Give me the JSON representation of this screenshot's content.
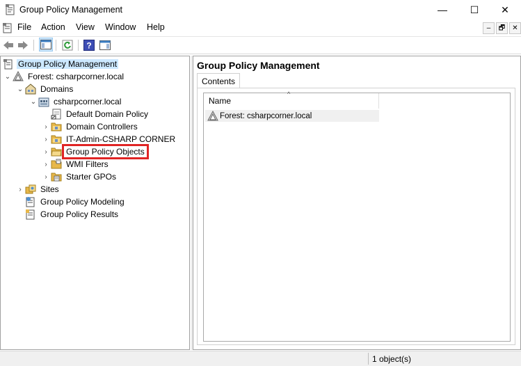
{
  "window": {
    "title": "Group Policy Management",
    "minimize_glyph": "—",
    "maximize_glyph": "☐",
    "close_glyph": "✕"
  },
  "menu": {
    "items": [
      "File",
      "Action",
      "View",
      "Window",
      "Help"
    ],
    "mdi_minimize": "–",
    "mdi_restore": "🗗",
    "mdi_close": "✕"
  },
  "toolbar": {
    "buttons": [
      "back-icon",
      "forward-icon",
      "show-hide-console-tree-icon",
      "refresh-icon",
      "help-icon",
      "show-action-pane-icon"
    ]
  },
  "tree": {
    "nodes": [
      {
        "label": "Group Policy Management",
        "icon": "gpm-icon",
        "selected": true
      },
      {
        "label": "Forest: csharpcorner.local",
        "icon": "forest-icon",
        "expander": "⌄"
      },
      {
        "label": "Domains",
        "icon": "domains-icon",
        "expander": "⌄"
      },
      {
        "label": "csharpcorner.local",
        "icon": "domain-icon",
        "expander": "⌄"
      },
      {
        "label": "Default Domain Policy",
        "icon": "gpo-link-icon"
      },
      {
        "label": "Domain Controllers",
        "icon": "ou-folder-icon",
        "expander": "›"
      },
      {
        "label": "IT-Admin-CSHARP CORNER",
        "icon": "ou-folder-icon",
        "expander": "›"
      },
      {
        "label": "Group Policy Objects",
        "icon": "gpo-folder-icon",
        "expander": "›",
        "highlighted": true
      },
      {
        "label": "WMI Filters",
        "icon": "wmi-folder-icon",
        "expander": "›"
      },
      {
        "label": "Starter GPOs",
        "icon": "starter-gpo-folder-icon",
        "expander": "›"
      },
      {
        "label": "Sites",
        "icon": "sites-icon",
        "expander": "›"
      },
      {
        "label": "Group Policy Modeling",
        "icon": "modeling-icon"
      },
      {
        "label": "Group Policy Results",
        "icon": "results-icon"
      }
    ]
  },
  "right_pane": {
    "title": "Group Policy Management",
    "tabs": [
      "Contents"
    ],
    "list": {
      "columns": [
        "Name"
      ],
      "sort_indicator": "^",
      "rows": [
        {
          "name": "Forest: csharpcorner.local",
          "icon": "forest-icon"
        }
      ]
    }
  },
  "status": {
    "text": "1 object(s)"
  },
  "colors": {
    "selection": "#cce8ff",
    "highlight_box": "#e02424",
    "folder": "#e8b84a"
  }
}
